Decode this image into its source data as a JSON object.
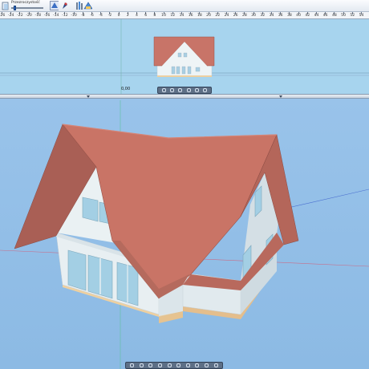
{
  "toolbar": {
    "transparency_label": "Przezroczystość",
    "tools": [
      {
        "name": "transparency-icon"
      },
      {
        "name": "view-mode-icon"
      },
      {
        "name": "pick-icon"
      },
      {
        "name": "columns-icon"
      },
      {
        "name": "level-icon"
      }
    ]
  },
  "ruler": {
    "labels": [
      "-26",
      "-24",
      "-22",
      "-20",
      "-18",
      "-16",
      "-14",
      "-12",
      "-10",
      "-8",
      "-6",
      "-4",
      "-2",
      "0",
      "2",
      "4",
      "6",
      "8",
      "10",
      "12",
      "14",
      "16",
      "18",
      "20",
      "22",
      "24",
      "26",
      "28",
      "30",
      "32",
      "34",
      "36",
      "38",
      "40",
      "42",
      "44",
      "46",
      "48",
      "50",
      "52",
      "54"
    ]
  },
  "elevation_view": {
    "level_label": "0,00"
  },
  "colors": {
    "roof": "#c87468",
    "wall": "#e9f1f4",
    "foundation": "#eed0a0",
    "sky_top_pane": "#a7d4ee",
    "sky_3d_pane": "#90bee6"
  }
}
